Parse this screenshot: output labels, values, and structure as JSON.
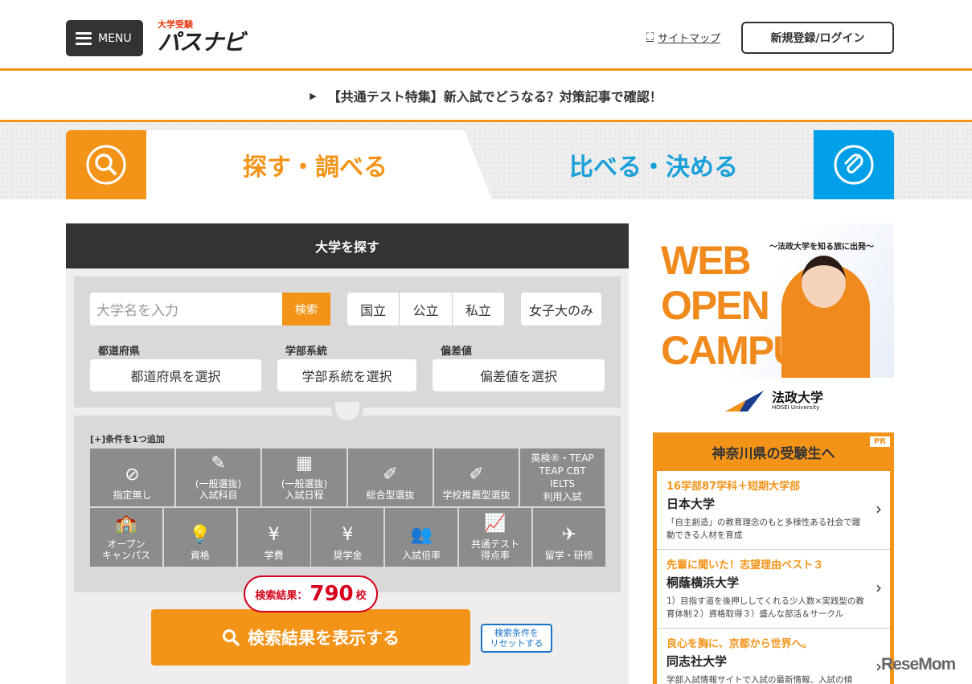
{
  "header": {
    "menu_label": "MENU",
    "logo_small": "大学受験",
    "logo_big": "パスナビ",
    "sitemap_label": "サイトマップ",
    "login_label": "新規登録/ログイン"
  },
  "notice": {
    "text": "【共通テスト特集】新入試でどうなる？対策記事で確認！"
  },
  "tabs": {
    "search": "探す・調べる",
    "compare": "比べる・決める"
  },
  "panel": {
    "title": "大学を探す",
    "search_placeholder": "大学名を入力",
    "search_button": "検索",
    "types": [
      "国立",
      "公立",
      "私立"
    ],
    "women_only": "女子大のみ",
    "filters": [
      {
        "label": "都道府県",
        "value": "都道府県を選択"
      },
      {
        "label": "学部系統",
        "value": "学部系統を選択"
      },
      {
        "label": "偏差値",
        "value": "偏差値を選択"
      }
    ],
    "add_condition": "[+]条件を1つ追加",
    "row1": [
      {
        "icon": "⊘",
        "l1": "",
        "l2": "指定無し"
      },
      {
        "icon": "✎",
        "l1": "(一般選抜)",
        "l2": "入試科目"
      },
      {
        "icon": "▦",
        "l1": "(一般選抜)",
        "l2": "入試日程"
      },
      {
        "icon": "✐",
        "l1": "",
        "l2": "総合型選抜"
      },
      {
        "icon": "✐",
        "l1": "",
        "l2": "学校推薦型選抜"
      }
    ],
    "eiken": [
      "英検®・TEAP",
      "TEAP CBT",
      "IELTS",
      "利用入試"
    ],
    "row2": [
      {
        "icon": "🏫",
        "l1": "オープン",
        "l2": "キャンパス"
      },
      {
        "icon": "💡",
        "l1": "",
        "l2": "資格"
      },
      {
        "icon": "¥",
        "l1": "",
        "l2": "学費"
      },
      {
        "icon": "¥",
        "l1": "",
        "l2": "奨学金"
      },
      {
        "icon": "👥",
        "l1": "",
        "l2": "入試倍率"
      },
      {
        "icon": "📈",
        "l1": "共通テスト",
        "l2": "得点率"
      },
      {
        "icon": "✈",
        "l1": "",
        "l2": "留学・研修"
      }
    ],
    "result_label": "検索結果：",
    "result_count": "790",
    "result_unit": "校",
    "show_results": "検索結果を表示する",
    "reset_l1": "検索条件を",
    "reset_l2": "リセットする"
  },
  "ad": {
    "headline": [
      "WEB",
      "OPEN",
      "CAMPUS"
    ],
    "sub": "〜法政大学を知る旅に出発〜",
    "univ": "法政大学",
    "univ_en": "HOSEI University"
  },
  "pr": {
    "title": "神奈川県の受験生へ",
    "badge": "PR",
    "items": [
      {
        "catch": "16学部87学科＋短期大学部",
        "name": "日本大学",
        "desc": "「自主創造」の教育理念のもと多様性ある社会で躍動できる人材を育成"
      },
      {
        "catch": "先輩に聞いた！志望理由ベスト３",
        "name": "桐蔭横浜大学",
        "desc": "1）目指す道を後押ししてくれる少人数×実践型の教育体制２）資格取得３）盛んな部活＆サークル"
      },
      {
        "catch": "良心を胸に、京都から世界へ。",
        "name": "同志社大学",
        "desc": "学部入試情報サイトで入試の最新情報、入試の傾"
      }
    ]
  },
  "watermark": "ReseMom"
}
